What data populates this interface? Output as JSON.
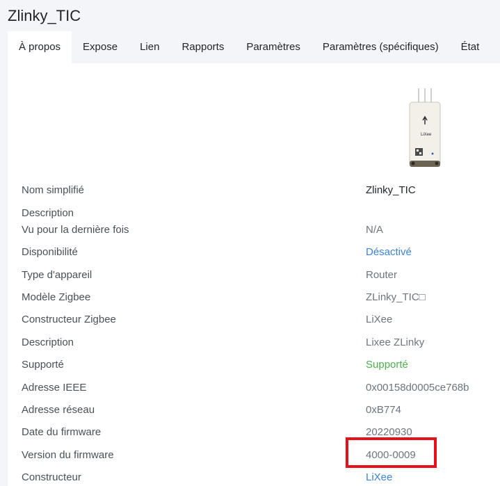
{
  "page": {
    "title": "Zlinky_TIC"
  },
  "tabs": [
    {
      "label": "À propos",
      "active": true
    },
    {
      "label": "Expose"
    },
    {
      "label": "Lien"
    },
    {
      "label": "Rapports"
    },
    {
      "label": "Paramètres"
    },
    {
      "label": "Paramètres (spécifiques)"
    },
    {
      "label": "État"
    }
  ],
  "device_image": {
    "icon": "lixee-zlinky-device-image",
    "brand_text": "LiXee"
  },
  "rows": [
    {
      "key": "Nom simplifié",
      "value": "Zlinky_TIC"
    },
    {
      "key": "Description",
      "value": ""
    },
    {
      "key": "Vu pour la dernière fois",
      "value": "N/A"
    },
    {
      "key": "Disponibilité",
      "value": "Désactivé"
    },
    {
      "key": "Type d'appareil",
      "value": "Router"
    },
    {
      "key": "Modèle Zigbee",
      "value": "ZLinky_TIC□"
    },
    {
      "key": "Constructeur Zigbee",
      "value": "LiXee"
    },
    {
      "key": "Description",
      "value": "Lixee ZLinky"
    },
    {
      "key": "Supporté",
      "value": "Supporté"
    },
    {
      "key": "Adresse IEEE",
      "value": "0x00158d0005ce768b"
    },
    {
      "key": "Adresse réseau",
      "value": "0xB774"
    },
    {
      "key": "Date du firmware",
      "value": "20220930"
    },
    {
      "key": "Version du firmware",
      "value": "4000-0009"
    },
    {
      "key": "Constructeur",
      "value": "LiXee"
    }
  ],
  "colors": {
    "link_blue": "#3d82d6",
    "supported_green": "#4cae4c",
    "highlight_red": "#e3111b"
  }
}
